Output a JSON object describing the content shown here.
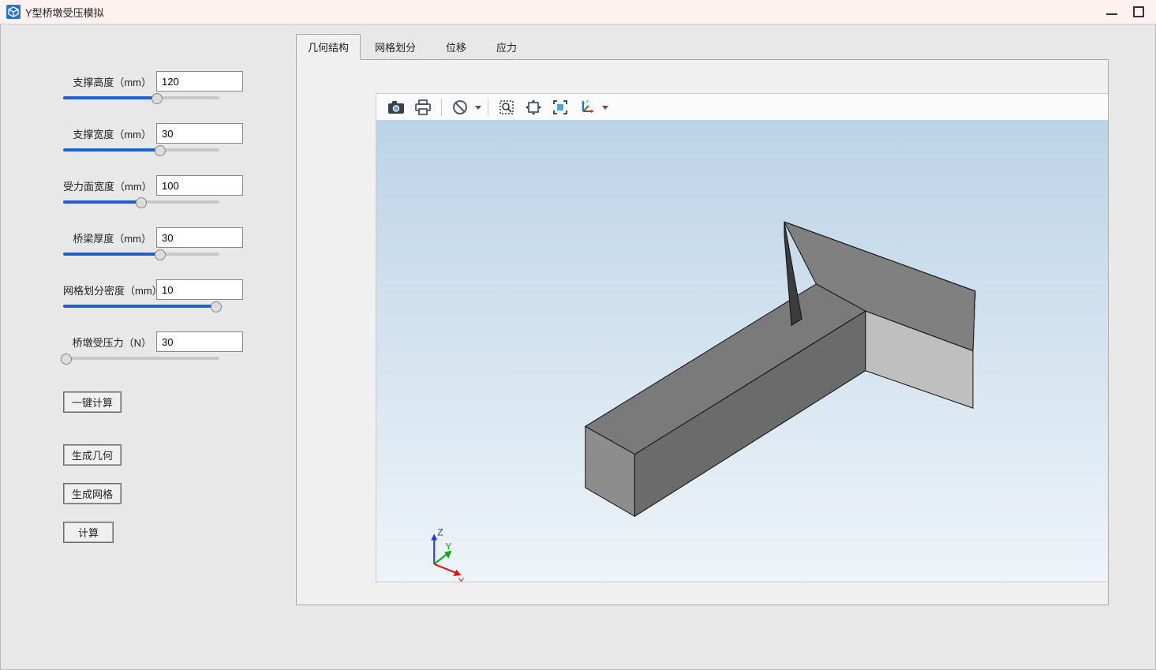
{
  "window": {
    "title": "Y型桥墩受压模拟"
  },
  "params": [
    {
      "label": "支撑高度（mm）",
      "value": "120",
      "percent": 60
    },
    {
      "label": "支撑宽度（mm）",
      "value": "30",
      "percent": 62
    },
    {
      "label": "受力面宽度（mm）",
      "value": "100",
      "percent": 50
    },
    {
      "label": "桥梁厚度（mm）",
      "value": "30",
      "percent": 62
    },
    {
      "label": "网格划分密度（mm）",
      "value": "10",
      "percent": 98
    },
    {
      "label": "桥墩受压力（N）",
      "value": "30",
      "percent": 2
    }
  ],
  "buttons": {
    "one_click": "一键计算",
    "gen_geom": "生成几何",
    "gen_mesh": "生成网格",
    "compute": "计算"
  },
  "tabs": [
    "几何结构",
    "网格划分",
    "位移",
    "应力"
  ],
  "active_tab": 0,
  "toolbar_icons": [
    "camera-icon",
    "print-icon",
    "forbid-icon",
    "zoom-box-icon",
    "pan-icon",
    "fit-icon",
    "axes-icon"
  ],
  "triad": {
    "x": "X",
    "y": "Y",
    "z": "Z"
  }
}
